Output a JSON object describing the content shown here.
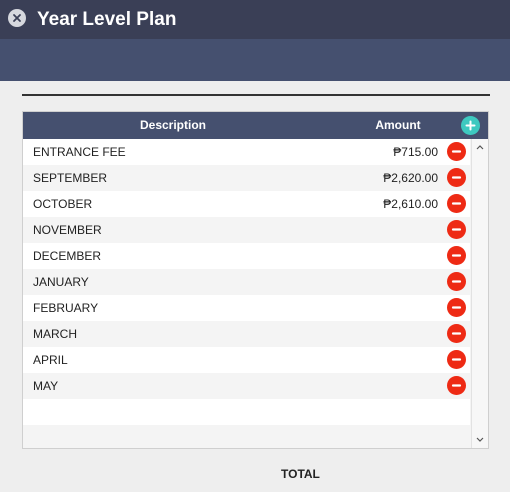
{
  "window": {
    "title": "Year Level Plan"
  },
  "grid": {
    "columns": {
      "description": "Description",
      "amount": "Amount"
    },
    "rows": [
      {
        "description": "ENTRANCE FEE",
        "amount": "₱715.00"
      },
      {
        "description": "SEPTEMBER",
        "amount": "₱2,620.00"
      },
      {
        "description": "OCTOBER",
        "amount": "₱2,610.00"
      },
      {
        "description": "NOVEMBER",
        "amount": ""
      },
      {
        "description": "DECEMBER",
        "amount": ""
      },
      {
        "description": "JANUARY",
        "amount": ""
      },
      {
        "description": "FEBRUARY",
        "amount": ""
      },
      {
        "description": "MARCH",
        "amount": ""
      },
      {
        "description": "APRIL",
        "amount": ""
      },
      {
        "description": "MAY",
        "amount": ""
      }
    ]
  },
  "footer": {
    "total_label": "TOTAL"
  },
  "colors": {
    "titlebar": "#3a3f56",
    "header": "#45506f",
    "add_button": "#3ec9c0",
    "delete_button": "#ee2a14"
  },
  "icons": {
    "close": "close-icon",
    "add": "plus-icon",
    "delete": "minus-icon",
    "scroll_up": "chevron-up-icon",
    "scroll_down": "chevron-down-icon"
  }
}
